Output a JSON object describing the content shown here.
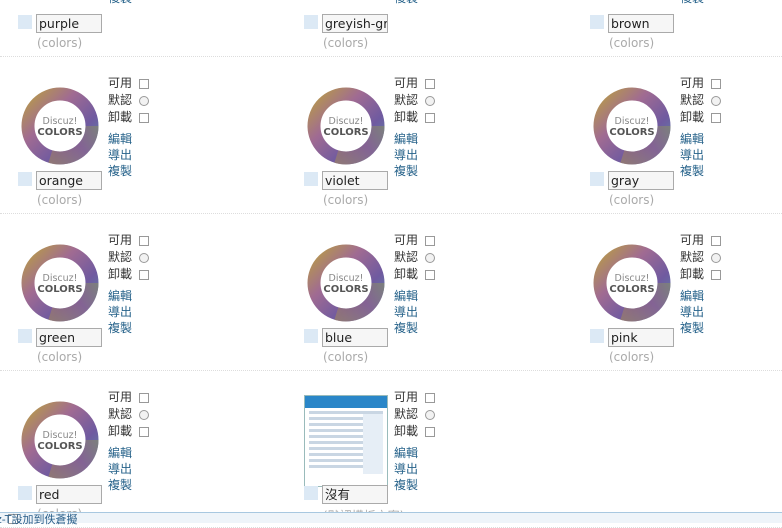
{
  "controls": {
    "available": "可用",
    "default": "默認",
    "uninstall": "卸載",
    "edit": "編輯",
    "export": "導出",
    "copy": "複製"
  },
  "logo": {
    "line1": "Discuz!",
    "line2": "COLORS"
  },
  "rows": [
    [
      {
        "name": "purple",
        "sub": "(colors)"
      },
      {
        "name": "greyish-gr",
        "sub": "(colors)"
      },
      {
        "name": "brown",
        "sub": "(colors)"
      }
    ],
    [
      {
        "name": "orange",
        "sub": "(colors)"
      },
      {
        "name": "violet",
        "sub": "(colors)"
      },
      {
        "name": "gray",
        "sub": "(colors)"
      }
    ],
    [
      {
        "name": "green",
        "sub": "(colors)"
      },
      {
        "name": "blue",
        "sub": "(colors)"
      },
      {
        "name": "pink",
        "sub": "(colors)"
      }
    ],
    [
      {
        "name": "red",
        "sub": "(colors)"
      },
      {
        "name": "沒有",
        "sub": "(默認模板方案)"
      }
    ]
  ],
  "footer": {
    "text": "z-T設加到佚蒼擬"
  },
  "colors": {
    "link": "#26628a",
    "accent": "#2a86c8"
  }
}
